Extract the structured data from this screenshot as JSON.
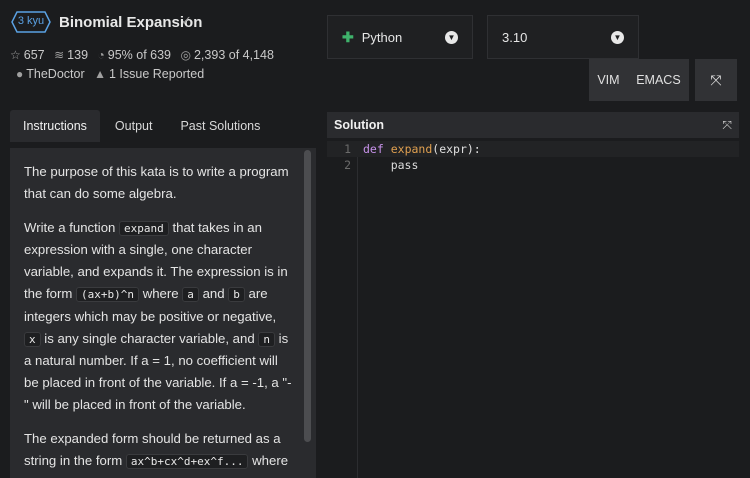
{
  "kata": {
    "rank": "3 kyu",
    "title": "Binomial Expansion",
    "stats": {
      "stars": "657",
      "collections": "139",
      "satisfaction": "95% of 639",
      "completed": "2,393 of 4,148",
      "author": "TheDoctor",
      "issues": "1 Issue Reported"
    }
  },
  "language": {
    "selected": "Python",
    "version": "3.10"
  },
  "editor_modes": {
    "vim": "VIM",
    "emacs": "EMACS"
  },
  "tabs": [
    "Instructions",
    "Output",
    "Past Solutions"
  ],
  "instructions": {
    "p1": "The purpose of this kata is to write a program that can do some algebra.",
    "p2": {
      "t1": "Write a function ",
      "c1": "expand",
      "t2": " that takes in an expression with a single, one character variable, and expands it. The expression is in the form ",
      "c2": "(ax+b)^n",
      "t3": " where ",
      "c3": "a",
      "t4": " and ",
      "c4": "b",
      "t5": " are integers which may be positive or negative, ",
      "c5": "x",
      "t6": " is any single character variable, and ",
      "c6": "n",
      "t7": " is a natural number. If a = 1, no coefficient will be placed in front of the variable. If a = -1, a \"-\" will be placed in front of the variable."
    },
    "p3": {
      "t1": "The expanded form should be returned as a string in the form ",
      "c1": "ax^b+cx^d+ex^f...",
      "t2": " where"
    }
  },
  "solution": {
    "header": "Solution",
    "lines": [
      {
        "num": "1",
        "kw": "def",
        "fn": "expand",
        "rest": "(expr):"
      },
      {
        "num": "2",
        "code": "    pass"
      }
    ]
  },
  "colors": {
    "rank_blue": "#5aa1e3",
    "python_green": "#3fb26b",
    "background": "#1b1c1e",
    "panel": "#2a2b2e"
  }
}
